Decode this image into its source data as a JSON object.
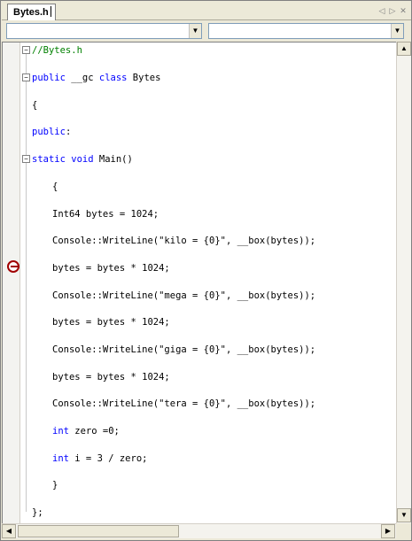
{
  "tab": {
    "label": "Bytes.h"
  },
  "nav": {
    "prev_icon": "◁",
    "next_icon": "▷",
    "close_icon": "✕"
  },
  "dropdowns": {
    "left_value": "",
    "right_value": "",
    "arrow": "▼"
  },
  "outline": {
    "collapse_glyph": "−"
  },
  "scroll": {
    "up": "▲",
    "down": "▼",
    "left": "◀",
    "right": "▶"
  },
  "colors": {
    "keyword": "#0000ff",
    "comment": "#008000",
    "breakpoint": "#a00000"
  },
  "code": {
    "l01": {
      "cm": "//Bytes.h"
    },
    "l02": {
      "kw": "public",
      "a": " __gc ",
      "kw2": "class",
      "b": " Bytes"
    },
    "l03": {
      "t": "{"
    },
    "l04": {
      "kw": "public",
      "t": ":"
    },
    "l05": {
      "kw": "static",
      "a": " ",
      "kw2": "void",
      "b": " Main()"
    },
    "l06": {
      "t": "{"
    },
    "l07": {
      "t": "Int64 bytes = 1024;"
    },
    "l08": {
      "t": "Console::WriteLine(\"kilo = {0}\", __box(bytes));"
    },
    "l09": {
      "t": "bytes = bytes * 1024;"
    },
    "l10": {
      "t": "Console::WriteLine(\"mega = {0}\", __box(bytes));"
    },
    "l11": {
      "t": "bytes = bytes * 1024;"
    },
    "l12": {
      "t": "Console::WriteLine(\"giga = {0}\", __box(bytes));"
    },
    "l13": {
      "t": "bytes = bytes * 1024;"
    },
    "l14": {
      "t": "Console::WriteLine(\"tera = {0}\", __box(bytes));"
    },
    "l15": {
      "kw": "int",
      "t": " zero =0;"
    },
    "l16": {
      "kw": "int",
      "t": " i = 3 / zero;"
    },
    "l17": {
      "t": "}"
    },
    "l18": {
      "t": "};"
    }
  }
}
